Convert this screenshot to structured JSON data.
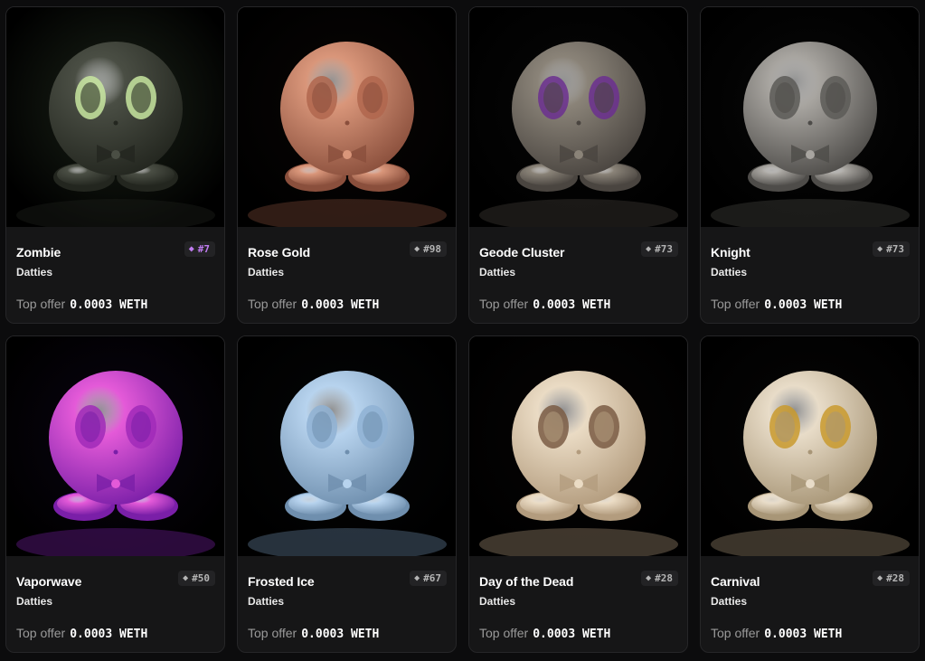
{
  "offer_label": "Top offer",
  "items": [
    {
      "name": "Zombie",
      "collection": "Datties",
      "rank": "#7",
      "rank_color": "#c07cf0",
      "offer": "0.0003 WETH",
      "body": "#4a4e44",
      "shade": "#23261f",
      "eyes": "#c8e6a0",
      "bg": "#1b2318"
    },
    {
      "name": "Rose Gold",
      "collection": "Datties",
      "rank": "#98",
      "rank_color": "#b4b4b4",
      "offer": "0.0003 WETH",
      "body": "#d9967a",
      "shade": "#8a4f3c",
      "eyes": "#b0664e",
      "bg": "#0a0605"
    },
    {
      "name": "Geode Cluster",
      "collection": "Datties",
      "rank": "#73",
      "rank_color": "#b4b4b4",
      "offer": "0.0003 WETH",
      "body": "#8a8378",
      "shade": "#4a4540",
      "eyes": "#6b2f8f",
      "bg": "#070707"
    },
    {
      "name": "Knight",
      "collection": "Datties",
      "rank": "#73",
      "rank_color": "#b4b4b4",
      "offer": "0.0003 WETH",
      "body": "#a8a5a0",
      "shade": "#4e4c49",
      "eyes": "#5c5a57",
      "bg": "#080808"
    },
    {
      "name": "Vaporwave",
      "collection": "Datties",
      "rank": "#50",
      "rank_color": "#b4b4b4",
      "offer": "0.0003 WETH",
      "body": "#e45ad8",
      "shade": "#7a1fa8",
      "eyes": "#a02ab8",
      "bg": "#0a0412"
    },
    {
      "name": "Frosted Ice",
      "collection": "Datties",
      "rank": "#67",
      "rank_color": "#b4b4b4",
      "offer": "0.0003 WETH",
      "body": "#b7d3ee",
      "shade": "#6f8fae",
      "eyes": "#8fb1d4",
      "bg": "#050607"
    },
    {
      "name": "Day of the Dead",
      "collection": "Datties",
      "rank": "#28",
      "rank_color": "#b4b4b4",
      "offer": "0.0003 WETH",
      "body": "#eadbc4",
      "shade": "#b39c7e",
      "eyes": "#7a5c44",
      "bg": "#070505"
    },
    {
      "name": "Carnival",
      "collection": "Datties",
      "rank": "#28",
      "rank_color": "#b4b4b4",
      "offer": "0.0003 WETH",
      "body": "#e8dcc8",
      "shade": "#a89677",
      "eyes": "#c99a2e",
      "bg": "#070606"
    }
  ]
}
